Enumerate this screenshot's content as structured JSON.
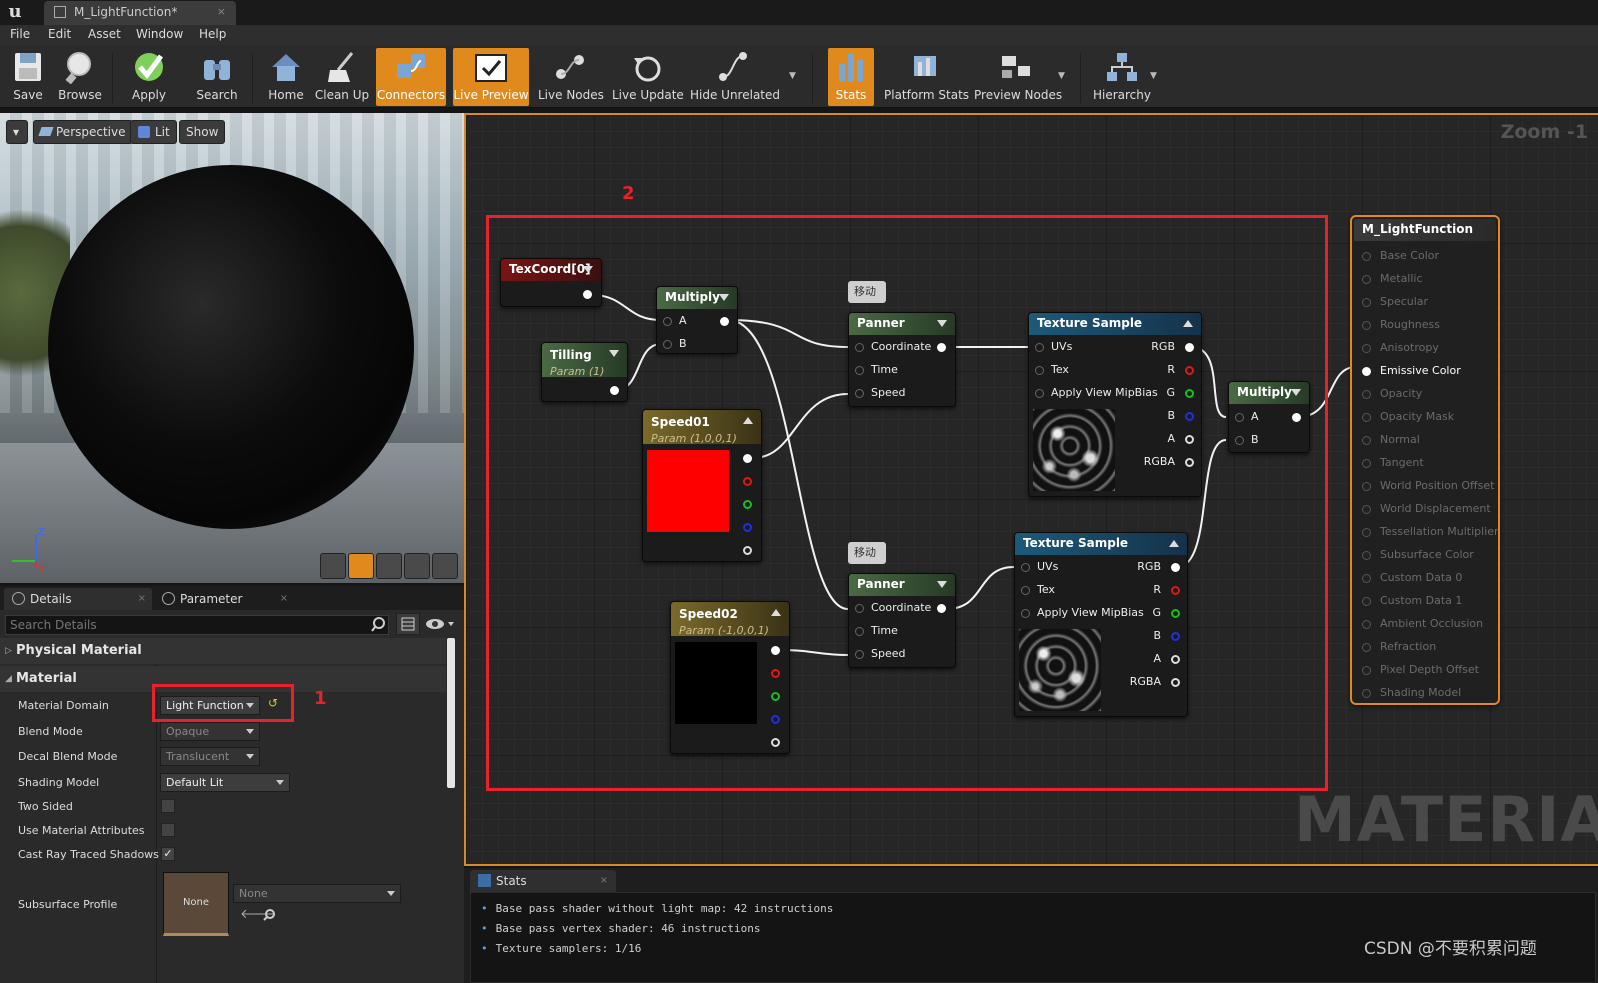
{
  "window": {
    "tab_title": "M_LightFunction*",
    "close": "×"
  },
  "menu": [
    "File",
    "Edit",
    "Asset",
    "Window",
    "Help"
  ],
  "toolbar": {
    "save": "Save",
    "browse": "Browse",
    "apply": "Apply",
    "search": "Search",
    "home": "Home",
    "clean_up": "Clean Up",
    "connectors": "Connectors",
    "live_preview": "Live Preview",
    "live_nodes": "Live Nodes",
    "live_update": "Live Update",
    "hide_unrelated": "Hide Unrelated",
    "stats": "Stats",
    "platform_stats": "Platform Stats",
    "preview_nodes": "Preview Nodes",
    "hierarchy": "Hierarchy"
  },
  "viewport": {
    "perspective": "Perspective",
    "lit": "Lit",
    "show": "Show",
    "axis_z": "Z",
    "axis_x": "X"
  },
  "details": {
    "tab_details": "Details",
    "tab_params": "Parameter Defaults",
    "search_placeholder": "Search Details",
    "cat_physical": "Physical Material",
    "cat_material": "Material",
    "props": {
      "material_domain": {
        "label": "Material Domain",
        "value": "Light Function"
      },
      "blend_mode": {
        "label": "Blend Mode",
        "value": "Opaque"
      },
      "decal_blend_mode": {
        "label": "Decal Blend Mode",
        "value": "Translucent"
      },
      "shading_model": {
        "label": "Shading Model",
        "value": "Default Lit"
      },
      "two_sided": {
        "label": "Two Sided"
      },
      "use_material_attributes": {
        "label": "Use Material Attributes"
      },
      "cast_ray_traced_shadows": {
        "label": "Cast Ray Traced Shadows",
        "check": "✓"
      },
      "subsurface_profile": {
        "label": "Subsurface Profile",
        "thumb": "None",
        "value": "None"
      }
    }
  },
  "graph": {
    "zoom": "Zoom -1",
    "watermark": "MATERIAL",
    "annotation_1": "1",
    "annotation_2": "2",
    "texcoord": {
      "title": "TexCoord[0]"
    },
    "tilling": {
      "title": "Tilling",
      "sub": "Param (1)"
    },
    "multiply1": {
      "title": "Multiply",
      "a": "A",
      "b": "B"
    },
    "speed01": {
      "title": "Speed01",
      "sub": "Param (1,0,0,1)"
    },
    "speed02": {
      "title": "Speed02",
      "sub": "Param (-1,0,0,1)"
    },
    "comment1": "移动",
    "comment2": "移动",
    "panner1": {
      "title": "Panner",
      "coordinate": "Coordinate",
      "time": "Time",
      "speed": "Speed"
    },
    "panner2": {
      "title": "Panner",
      "coordinate": "Coordinate",
      "time": "Time",
      "speed": "Speed"
    },
    "texsample1": {
      "title": "Texture Sample",
      "uvs": "UVs",
      "tex": "Tex",
      "mip": "Apply View MipBias",
      "rgb": "RGB",
      "r": "R",
      "g": "G",
      "b": "B",
      "a": "A",
      "rgba": "RGBA"
    },
    "texsample2": {
      "title": "Texture Sample",
      "uvs": "UVs",
      "tex": "Tex",
      "mip": "Apply View MipBias",
      "rgb": "RGB",
      "r": "R",
      "g": "G",
      "b": "B",
      "a": "A",
      "rgba": "RGBA"
    },
    "multiply2": {
      "title": "Multiply",
      "a": "A",
      "b": "B"
    },
    "main": {
      "title": "M_LightFunction",
      "pins": [
        "Base Color",
        "Metallic",
        "Specular",
        "Roughness",
        "Anisotropy",
        "Emissive Color",
        "Opacity",
        "Opacity Mask",
        "Normal",
        "Tangent",
        "World Position Offset",
        "World Displacement",
        "Tessellation Multiplier",
        "Subsurface Color",
        "Custom Data 0",
        "Custom Data 1",
        "Ambient Occlusion",
        "Refraction",
        "Pixel Depth Offset",
        "Shading Model"
      ],
      "active_pin": "Emissive Color"
    }
  },
  "stats": {
    "tab": "Stats",
    "lines": [
      "Base pass shader without light map: 42 instructions",
      "Base pass vertex shader: 46 instructions",
      "Texture samplers: 1/16"
    ]
  },
  "watermark_csdn": "CSDN @不要积累问题",
  "colors": {
    "accent": "#e08a1e",
    "annotation": "#e8222a",
    "speed01_swatch": "#ff0000",
    "speed02_swatch": "#000000"
  }
}
